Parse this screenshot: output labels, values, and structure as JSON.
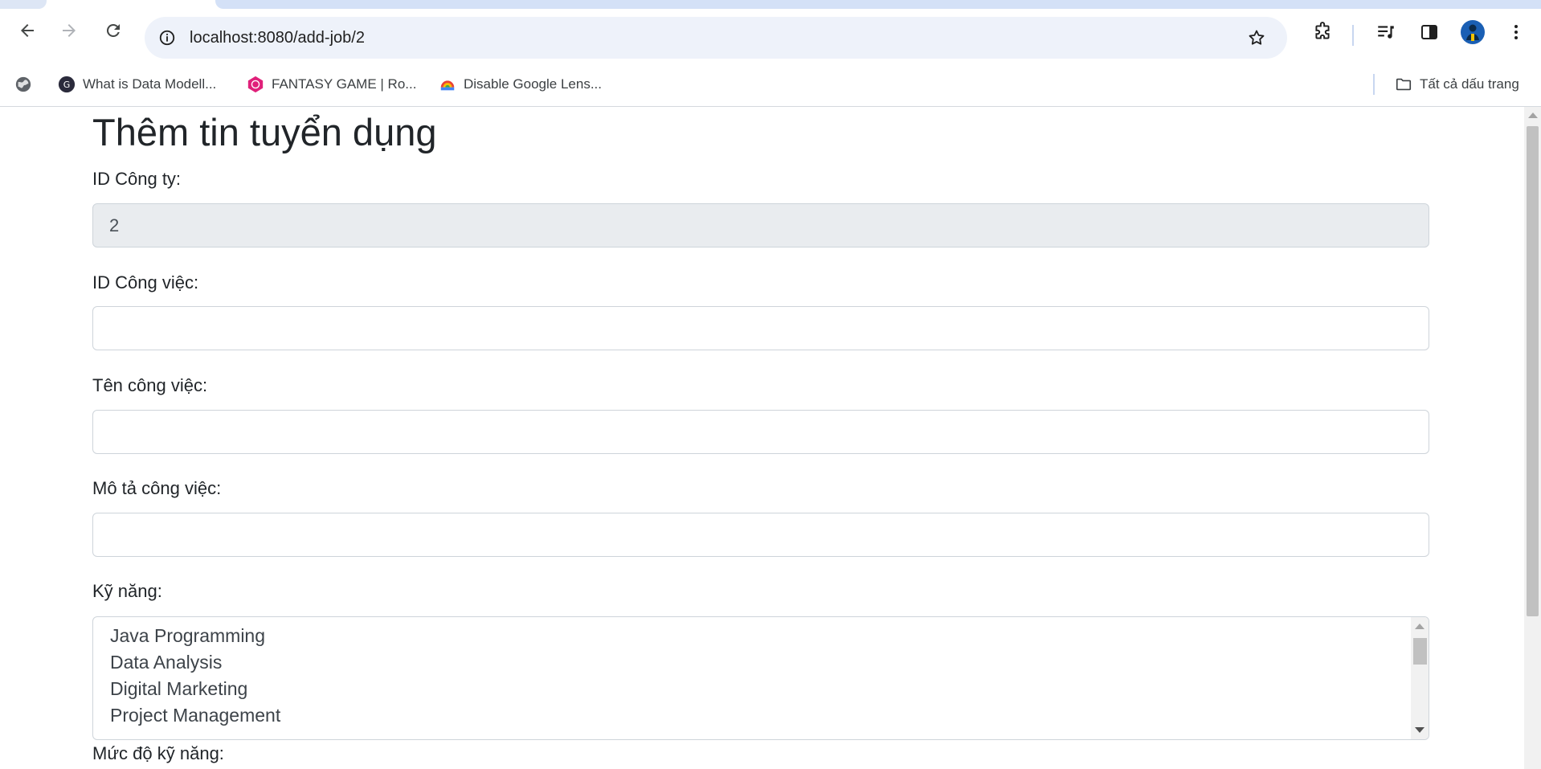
{
  "browser": {
    "url": "localhost:8080/add-job/2",
    "bookmarks": [
      {
        "label": "What is Data Modell...",
        "icon": "g-favicon-icon"
      },
      {
        "label": "FANTASY GAME | Ro...",
        "icon": "game-favicon-icon"
      },
      {
        "label": "Disable Google Lens...",
        "icon": "extension-favicon-icon"
      }
    ],
    "all_bookmarks": "Tất cả dấu trang"
  },
  "form": {
    "title": "Thêm tin tuyển dụng",
    "company_id_label": "ID Công ty:",
    "company_id_value": "2",
    "job_id_label": "ID Công việc:",
    "job_id_value": "",
    "job_name_label": "Tên công việc:",
    "job_name_value": "",
    "job_desc_label": "Mô tả công việc:",
    "job_desc_value": "",
    "skills_label": "Kỹ năng:",
    "skills_options": [
      "Java Programming",
      "Data Analysis",
      "Digital Marketing",
      "Project Management"
    ],
    "skill_level_label": "Mức độ kỹ năng:"
  },
  "colors": {
    "accent": "#1a73e8",
    "text": "#212529",
    "readonly_bg": "#e9ecef",
    "border": "#ced4da"
  }
}
